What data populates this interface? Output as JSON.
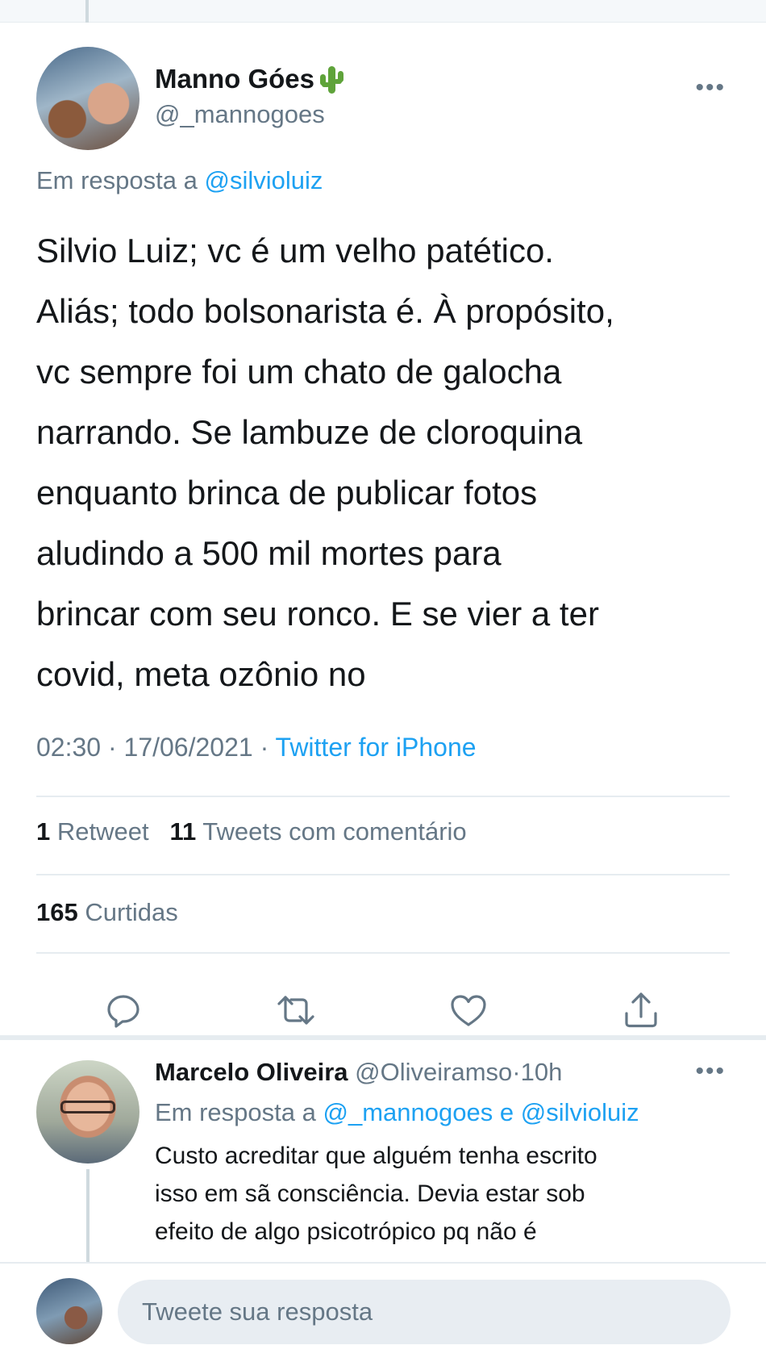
{
  "main_tweet": {
    "display_name": "Manno Góes",
    "name_emoji": "cactus-icon",
    "handle": "@_mannogoes",
    "reply_prefix": "Em resposta a",
    "reply_mention": "@silvioluiz",
    "text_lines": [
      "Silvio Luiz; vc é um velho patético.",
      "Aliás; todo bolsonarista é. À propósito,",
      "vc sempre foi um chato de galocha",
      "narrando. Se lambuze de cloroquina",
      "enquanto brinca de publicar fotos",
      "aludindo a 500 mil mortes para",
      "brincar com seu ronco. E se vier a ter",
      "covid, meta ozônio no"
    ],
    "time": "02:30",
    "date": "17/06/2021",
    "separator": "·",
    "source": "Twitter for iPhone",
    "retweets_count": "1",
    "retweets_label": "Retweet",
    "quotes_count": "11",
    "quotes_label": "Tweets com comentário",
    "likes_count": "165",
    "likes_label": "Curtidas"
  },
  "reply_tweet": {
    "display_name": "Marcelo Oliveira",
    "handle": "@Oliveiramso",
    "separator": "·",
    "time_ago": "10h",
    "reply_prefix": "Em resposta a",
    "mention_1": "@_mannogoes",
    "conjunction": "e",
    "mention_2": "@silvioluiz",
    "text_lines": [
      "Custo acreditar que alguém tenha escrito",
      "isso em sã consciência. Devia estar sob",
      "efeito de algo psicotrópico pq não é"
    ]
  },
  "compose": {
    "placeholder": "Tweete sua resposta"
  },
  "colors": {
    "accent": "#1da1f2",
    "secondary_text": "#657786",
    "primary_text": "#14171a",
    "divider": "#e6ecf0"
  }
}
